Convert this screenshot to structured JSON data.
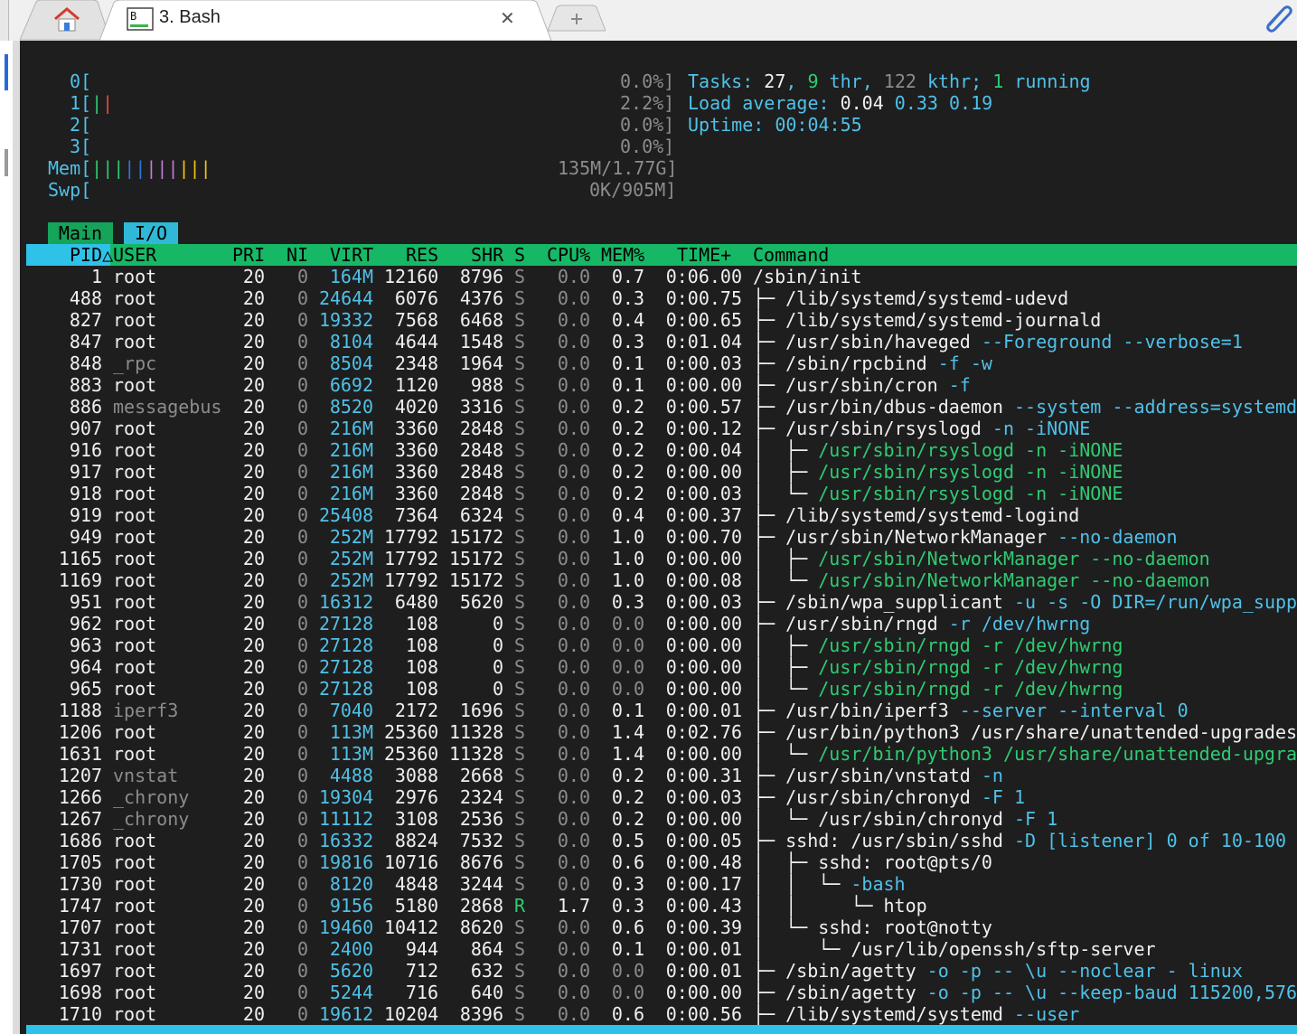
{
  "tabs": {
    "home_title": "",
    "active_title": "3. Bash",
    "close_symbol": "✕",
    "newtab_symbol": "+"
  },
  "meters": {
    "cpu": [
      {
        "label": "0[",
        "bar": "",
        "value": "0.0%]"
      },
      {
        "label": "1[",
        "bar": "||",
        "value": "2.2%]"
      },
      {
        "label": "2[",
        "bar": "",
        "value": "0.0%]"
      },
      {
        "label": "3[",
        "bar": "",
        "value": "0.0%]"
      }
    ],
    "mem": {
      "label": "Mem[",
      "bar_g": "|||",
      "bar_b": "||",
      "bar_m": "|||",
      "bar_y": "|||",
      "value": "135M/1.77G]"
    },
    "swp": {
      "label": "Swp[",
      "value": "0K/905M]"
    }
  },
  "summary": {
    "tasks_label": "Tasks: ",
    "tasks": "27",
    "comma1": ", ",
    "thr": "9",
    "thr_label": " thr",
    "comma2": ", ",
    "kthr": "122",
    "kthr_label": " kthr; ",
    "running": "1",
    "running_label": " running",
    "load_label": "Load average: ",
    "load1": "0.04",
    "load5": "0.33",
    "load15": "0.19",
    "uptime_label": "Uptime: ",
    "uptime": "00:04:55"
  },
  "tabs_htop": {
    "main": "Main",
    "io": "I/O"
  },
  "columns": {
    "pid": "PID△",
    "user": "USER",
    "pri": "PRI",
    "ni": "NI",
    "virt": "VIRT",
    "res": "RES",
    "shr": "SHR",
    "s": "S",
    "cpu": "CPU%",
    "mem": "MEM%",
    "time": "TIME+",
    "command": "Command"
  },
  "processes": [
    {
      "pid": "1",
      "user": "root",
      "pri": "20",
      "ni": "0",
      "virt": "164M",
      "res": "12160",
      "shr": "8796",
      "s": "S",
      "cpu": "0.0",
      "mem": "0.7",
      "time": "0:06.00",
      "tree": "",
      "cmd": "/sbin/init",
      "args": ""
    },
    {
      "pid": "488",
      "user": "root",
      "pri": "20",
      "ni": "0",
      "virt": "24644",
      "res": "6076",
      "shr": "4376",
      "s": "S",
      "cpu": "0.0",
      "mem": "0.3",
      "time": "0:00.75",
      "tree": "├─ ",
      "cmd": "/lib/systemd/systemd-udevd",
      "args": ""
    },
    {
      "pid": "827",
      "user": "root",
      "pri": "20",
      "ni": "0",
      "virt": "19332",
      "res": "7568",
      "shr": "6468",
      "s": "S",
      "cpu": "0.0",
      "mem": "0.4",
      "time": "0:00.65",
      "tree": "├─ ",
      "cmd": "/lib/systemd/systemd-journald",
      "args": ""
    },
    {
      "pid": "847",
      "user": "root",
      "pri": "20",
      "ni": "0",
      "virt": "8104",
      "res": "4644",
      "shr": "1548",
      "s": "S",
      "cpu": "0.0",
      "mem": "0.3",
      "time": "0:01.04",
      "tree": "├─ ",
      "cmd": "/usr/sbin/haveged",
      "args": " --Foreground --verbose=1"
    },
    {
      "pid": "848",
      "user": "_rpc",
      "pri": "20",
      "ni": "0",
      "virt": "8504",
      "res": "2348",
      "shr": "1964",
      "s": "S",
      "cpu": "0.0",
      "mem": "0.1",
      "time": "0:00.03",
      "tree": "├─ ",
      "cmd": "/sbin/rpcbind",
      "args": " -f -w"
    },
    {
      "pid": "883",
      "user": "root",
      "pri": "20",
      "ni": "0",
      "virt": "6692",
      "res": "1120",
      "shr": "988",
      "s": "S",
      "cpu": "0.0",
      "mem": "0.1",
      "time": "0:00.00",
      "tree": "├─ ",
      "cmd": "/usr/sbin/cron",
      "args": " -f"
    },
    {
      "pid": "886",
      "user": "messagebus",
      "pri": "20",
      "ni": "0",
      "virt": "8520",
      "res": "4020",
      "shr": "3316",
      "s": "S",
      "cpu": "0.0",
      "mem": "0.2",
      "time": "0:00.57",
      "tree": "├─ ",
      "cmd": "/usr/bin/dbus-daemon",
      "args": " --system --address=systemd"
    },
    {
      "pid": "907",
      "user": "root",
      "pri": "20",
      "ni": "0",
      "virt": "216M",
      "res": "3360",
      "shr": "2848",
      "s": "S",
      "cpu": "0.0",
      "mem": "0.2",
      "time": "0:00.12",
      "tree": "├─ ",
      "cmd": "/usr/sbin/rsyslogd",
      "args": " -n -iNONE"
    },
    {
      "pid": "916",
      "user": "root",
      "pri": "20",
      "ni": "0",
      "virt": "216M",
      "res": "3360",
      "shr": "2848",
      "s": "S",
      "cpu": "0.0",
      "mem": "0.2",
      "time": "0:00.04",
      "tree": "│  ├─ ",
      "cmd": "/usr/sbin/rsyslogd -n -iNONE",
      "args": "",
      "thread": true
    },
    {
      "pid": "917",
      "user": "root",
      "pri": "20",
      "ni": "0",
      "virt": "216M",
      "res": "3360",
      "shr": "2848",
      "s": "S",
      "cpu": "0.0",
      "mem": "0.2",
      "time": "0:00.00",
      "tree": "│  ├─ ",
      "cmd": "/usr/sbin/rsyslogd -n -iNONE",
      "args": "",
      "thread": true
    },
    {
      "pid": "918",
      "user": "root",
      "pri": "20",
      "ni": "0",
      "virt": "216M",
      "res": "3360",
      "shr": "2848",
      "s": "S",
      "cpu": "0.0",
      "mem": "0.2",
      "time": "0:00.03",
      "tree": "│  └─ ",
      "cmd": "/usr/sbin/rsyslogd -n -iNONE",
      "args": "",
      "thread": true
    },
    {
      "pid": "919",
      "user": "root",
      "pri": "20",
      "ni": "0",
      "virt": "25408",
      "res": "7364",
      "shr": "6324",
      "s": "S",
      "cpu": "0.0",
      "mem": "0.4",
      "time": "0:00.37",
      "tree": "├─ ",
      "cmd": "/lib/systemd/systemd-logind",
      "args": ""
    },
    {
      "pid": "949",
      "user": "root",
      "pri": "20",
      "ni": "0",
      "virt": "252M",
      "res": "17792",
      "shr": "15172",
      "s": "S",
      "cpu": "0.0",
      "mem": "1.0",
      "time": "0:00.70",
      "tree": "├─ ",
      "cmd": "/usr/sbin/NetworkManager",
      "args": " --no-daemon"
    },
    {
      "pid": "1165",
      "user": "root",
      "pri": "20",
      "ni": "0",
      "virt": "252M",
      "res": "17792",
      "shr": "15172",
      "s": "S",
      "cpu": "0.0",
      "mem": "1.0",
      "time": "0:00.00",
      "tree": "│  ├─ ",
      "cmd": "/usr/sbin/NetworkManager --no-daemon",
      "args": "",
      "thread": true
    },
    {
      "pid": "1169",
      "user": "root",
      "pri": "20",
      "ni": "0",
      "virt": "252M",
      "res": "17792",
      "shr": "15172",
      "s": "S",
      "cpu": "0.0",
      "mem": "1.0",
      "time": "0:00.08",
      "tree": "│  └─ ",
      "cmd": "/usr/sbin/NetworkManager --no-daemon",
      "args": "",
      "thread": true
    },
    {
      "pid": "951",
      "user": "root",
      "pri": "20",
      "ni": "0",
      "virt": "16312",
      "res": "6480",
      "shr": "5620",
      "s": "S",
      "cpu": "0.0",
      "mem": "0.3",
      "time": "0:00.03",
      "tree": "├─ ",
      "cmd": "/sbin/wpa_supplicant",
      "args": " -u -s -O DIR=/run/wpa_supp"
    },
    {
      "pid": "962",
      "user": "root",
      "pri": "20",
      "ni": "0",
      "virt": "27128",
      "res": "108",
      "shr": "0",
      "s": "S",
      "cpu": "0.0",
      "mem": "0.0",
      "time": "0:00.00",
      "tree": "├─ ",
      "cmd": "/usr/sbin/rngd",
      "args": " -r /dev/hwrng"
    },
    {
      "pid": "963",
      "user": "root",
      "pri": "20",
      "ni": "0",
      "virt": "27128",
      "res": "108",
      "shr": "0",
      "s": "S",
      "cpu": "0.0",
      "mem": "0.0",
      "time": "0:00.00",
      "tree": "│  ├─ ",
      "cmd": "/usr/sbin/rngd -r /dev/hwrng",
      "args": "",
      "thread": true
    },
    {
      "pid": "964",
      "user": "root",
      "pri": "20",
      "ni": "0",
      "virt": "27128",
      "res": "108",
      "shr": "0",
      "s": "S",
      "cpu": "0.0",
      "mem": "0.0",
      "time": "0:00.00",
      "tree": "│  ├─ ",
      "cmd": "/usr/sbin/rngd -r /dev/hwrng",
      "args": "",
      "thread": true
    },
    {
      "pid": "965",
      "user": "root",
      "pri": "20",
      "ni": "0",
      "virt": "27128",
      "res": "108",
      "shr": "0",
      "s": "S",
      "cpu": "0.0",
      "mem": "0.0",
      "time": "0:00.00",
      "tree": "│  └─ ",
      "cmd": "/usr/sbin/rngd -r /dev/hwrng",
      "args": "",
      "thread": true
    },
    {
      "pid": "1188",
      "user": "iperf3",
      "pri": "20",
      "ni": "0",
      "virt": "7040",
      "res": "2172",
      "shr": "1696",
      "s": "S",
      "cpu": "0.0",
      "mem": "0.1",
      "time": "0:00.01",
      "tree": "├─ ",
      "cmd": "/usr/bin/iperf3",
      "args": " --server --interval 0"
    },
    {
      "pid": "1206",
      "user": "root",
      "pri": "20",
      "ni": "0",
      "virt": "113M",
      "res": "25360",
      "shr": "11328",
      "s": "S",
      "cpu": "0.0",
      "mem": "1.4",
      "time": "0:02.76",
      "tree": "├─ ",
      "cmd": "/usr/bin/python3 /usr/share/unattended-upgrades",
      "args": ""
    },
    {
      "pid": "1631",
      "user": "root",
      "pri": "20",
      "ni": "0",
      "virt": "113M",
      "res": "25360",
      "shr": "11328",
      "s": "S",
      "cpu": "0.0",
      "mem": "1.4",
      "time": "0:00.00",
      "tree": "│  └─ ",
      "cmd": "/usr/bin/python3 /usr/share/unattended-upgra",
      "args": "",
      "thread": true
    },
    {
      "pid": "1207",
      "user": "vnstat",
      "pri": "20",
      "ni": "0",
      "virt": "4488",
      "res": "3088",
      "shr": "2668",
      "s": "S",
      "cpu": "0.0",
      "mem": "0.2",
      "time": "0:00.31",
      "tree": "├─ ",
      "cmd": "/usr/sbin/vnstatd",
      "args": " -n"
    },
    {
      "pid": "1266",
      "user": "_chrony",
      "pri": "20",
      "ni": "0",
      "virt": "19304",
      "res": "2976",
      "shr": "2324",
      "s": "S",
      "cpu": "0.0",
      "mem": "0.2",
      "time": "0:00.03",
      "tree": "├─ ",
      "cmd": "/usr/sbin/chronyd",
      "args": " -F 1"
    },
    {
      "pid": "1267",
      "user": "_chrony",
      "pri": "20",
      "ni": "0",
      "virt": "11112",
      "res": "3108",
      "shr": "2536",
      "s": "S",
      "cpu": "0.0",
      "mem": "0.2",
      "time": "0:00.00",
      "tree": "│  └─ ",
      "cmd": "/usr/sbin/chronyd",
      "args": " -F 1"
    },
    {
      "pid": "1686",
      "user": "root",
      "pri": "20",
      "ni": "0",
      "virt": "16332",
      "res": "8824",
      "shr": "7532",
      "s": "S",
      "cpu": "0.0",
      "mem": "0.5",
      "time": "0:00.05",
      "tree": "├─ ",
      "cmd": "sshd: /usr/sbin/sshd",
      "args": " -D [listener] 0 of 10-100"
    },
    {
      "pid": "1705",
      "user": "root",
      "pri": "20",
      "ni": "0",
      "virt": "19816",
      "res": "10716",
      "shr": "8676",
      "s": "S",
      "cpu": "0.0",
      "mem": "0.6",
      "time": "0:00.48",
      "tree": "│  ├─ ",
      "cmd": "sshd: root@pts/0",
      "args": ""
    },
    {
      "pid": "1730",
      "user": "root",
      "pri": "20",
      "ni": "0",
      "virt": "8120",
      "res": "4848",
      "shr": "3244",
      "s": "S",
      "cpu": "0.0",
      "mem": "0.3",
      "time": "0:00.17",
      "tree": "│  │  └─ ",
      "cmd": "-bash",
      "args": "",
      "cyan": true
    },
    {
      "pid": "1747",
      "user": "root",
      "pri": "20",
      "ni": "0",
      "virt": "9156",
      "res": "5180",
      "shr": "2868",
      "s": "R",
      "cpu": "1.7",
      "mem": "0.3",
      "time": "0:00.43",
      "tree": "│  │     └─ ",
      "cmd": "htop",
      "args": ""
    },
    {
      "pid": "1707",
      "user": "root",
      "pri": "20",
      "ni": "0",
      "virt": "19460",
      "res": "10412",
      "shr": "8620",
      "s": "S",
      "cpu": "0.0",
      "mem": "0.6",
      "time": "0:00.39",
      "tree": "│  └─ ",
      "cmd": "sshd: root@notty",
      "args": ""
    },
    {
      "pid": "1731",
      "user": "root",
      "pri": "20",
      "ni": "0",
      "virt": "2400",
      "res": "944",
      "shr": "864",
      "s": "S",
      "cpu": "0.0",
      "mem": "0.1",
      "time": "0:00.01",
      "tree": "│     └─ ",
      "cmd": "/usr/lib/openssh/sftp-server",
      "args": ""
    },
    {
      "pid": "1697",
      "user": "root",
      "pri": "20",
      "ni": "0",
      "virt": "5620",
      "res": "712",
      "shr": "632",
      "s": "S",
      "cpu": "0.0",
      "mem": "0.0",
      "time": "0:00.01",
      "tree": "├─ ",
      "cmd": "/sbin/agetty",
      "args": " -o -p -- \\u --noclear - linux"
    },
    {
      "pid": "1698",
      "user": "root",
      "pri": "20",
      "ni": "0",
      "virt": "5244",
      "res": "716",
      "shr": "640",
      "s": "S",
      "cpu": "0.0",
      "mem": "0.0",
      "time": "0:00.00",
      "tree": "├─ ",
      "cmd": "/sbin/agetty",
      "args": " -o -p -- \\u --keep-baud 115200,576"
    },
    {
      "pid": "1710",
      "user": "root",
      "pri": "20",
      "ni": "0",
      "virt": "19612",
      "res": "10204",
      "shr": "8396",
      "s": "S",
      "cpu": "0.0",
      "mem": "0.6",
      "time": "0:00.56",
      "tree": "├─ ",
      "cmd": "/lib/systemd/systemd",
      "args": " --user"
    }
  ],
  "colors": {
    "background": "#1e1e1e",
    "cyan": "#4fc1e9",
    "green": "#2ecc71",
    "header_green": "#16b865",
    "pid_header_cyan": "#2fc2e8"
  }
}
